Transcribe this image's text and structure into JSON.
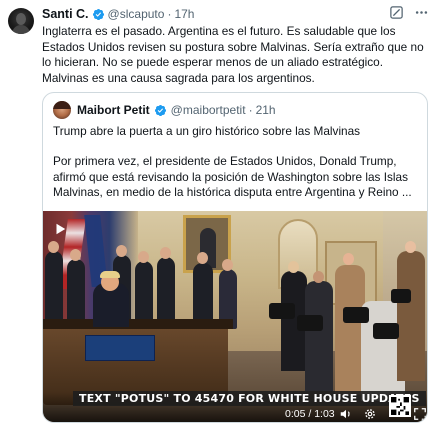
{
  "tweet": {
    "name": "Santi C.",
    "handle": "@slcaputo",
    "separator": "·",
    "time": "17h",
    "text": "Inglaterra es el pasado. Argentina es el futuro. Es saludable que los Estados Unidos revisen su postura sobre Malvinas. Sería extraño que no lo hicieran. No se puede esperar menos de un aliado estratégico. Malvinas es una causa sagrada para los argentinos."
  },
  "quote": {
    "name": "Maibort Petit",
    "handle": "@maibortpetit",
    "separator": "·",
    "time": "21h",
    "headline": "Trump abre la puerta a un giro histórico sobre las Malvinas",
    "body": "Por primera vez, el presidente de Estados Unidos, Donald Trump, afirmó que está revisando la posición de Washington sobre las Islas Malvinas, en medio de la histórica disputa entre Argentina y Reino ..."
  },
  "video": {
    "banner": "TEXT \"POTUS\" TO 45470 FOR WHITE HOUSE UPDATES",
    "time_display": "0:05 / 1:03",
    "progress_fraction": 0.08
  },
  "icons": {
    "verified": "verified-badge-icon",
    "grok": "grok-icon",
    "more": "more-icon",
    "play": "play-icon",
    "mute": "volume-icon",
    "settings": "gear-icon",
    "qr": "qr-code-icon",
    "fullscreen": "fullscreen-icon"
  },
  "colors": {
    "verified": "#1d9bf0",
    "secondary_text": "#536471",
    "border": "#cfd9de"
  }
}
